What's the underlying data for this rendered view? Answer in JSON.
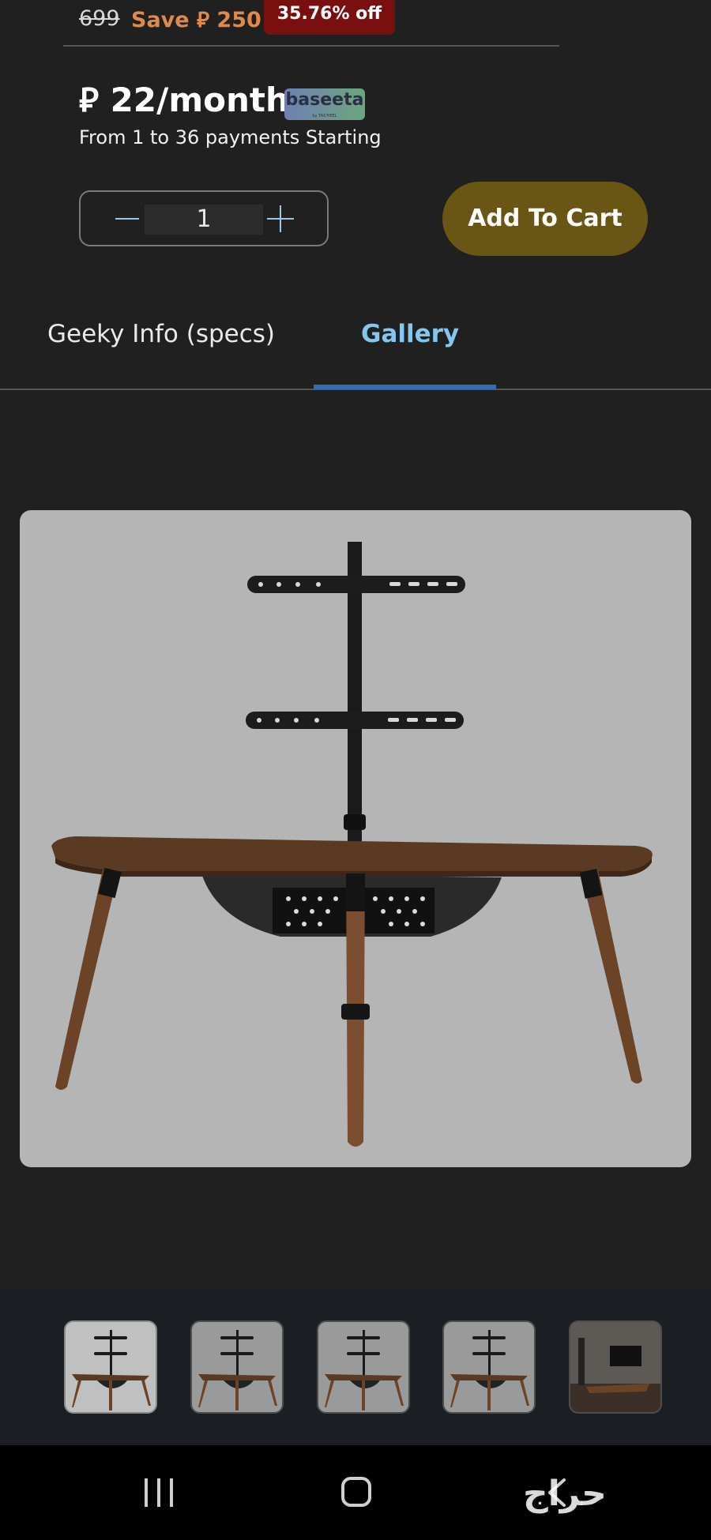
{
  "price": {
    "old_price": "699",
    "save_text": "Save ⃁ 250",
    "discount_badge": "35.76% off"
  },
  "installment": {
    "monthly_text": "⃁ 22/month",
    "provider_logo": "baseeta",
    "provider_logo_subtext": "by TAS'HEEL",
    "payments_text": "From 1 to 36 payments Starting"
  },
  "quantity": {
    "value": "1",
    "minus_icon": "minus-icon",
    "plus_icon": "plus-icon"
  },
  "cart": {
    "add_label": "Add To Cart",
    "button_color": "#6a5614"
  },
  "tabs": [
    {
      "label": "Geeky Info (specs)",
      "active": false
    },
    {
      "label": "Gallery",
      "active": true
    }
  ],
  "gallery": {
    "main_image": "tv-stand-corner-table",
    "thumbnails": [
      {
        "name": "tv-stand-front",
        "active": true
      },
      {
        "name": "tv-stand-angle-left",
        "active": false
      },
      {
        "name": "tv-stand-angle-right",
        "active": false
      },
      {
        "name": "tv-stand-side",
        "active": false
      },
      {
        "name": "tv-stand-room-scene",
        "active": false
      }
    ]
  },
  "system_nav": {
    "recent_icon": "recent-apps-icon",
    "home_icon": "home-icon",
    "back_icon": "back-icon"
  },
  "watermark": {
    "text": "حراج"
  }
}
